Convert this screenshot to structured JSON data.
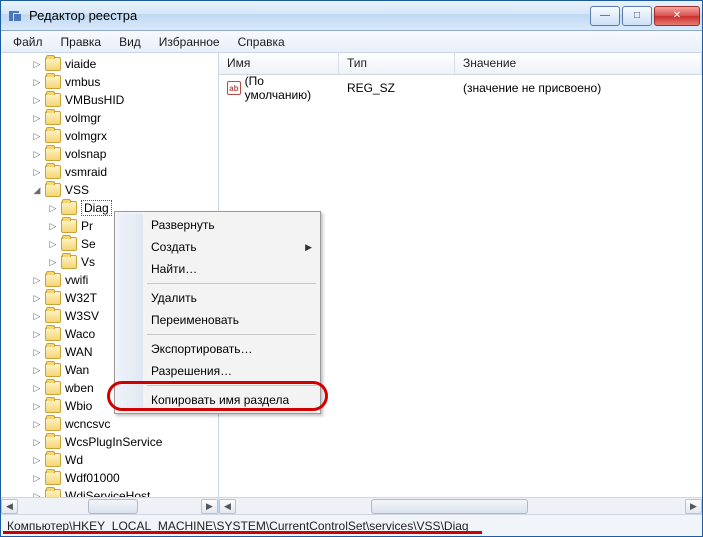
{
  "window": {
    "title": "Редактор реестра"
  },
  "menu": {
    "file": "Файл",
    "edit": "Правка",
    "view": "Вид",
    "favorites": "Избранное",
    "help": "Справка"
  },
  "tree": {
    "items": [
      {
        "label": "viaide",
        "level": 1,
        "tw": "▷"
      },
      {
        "label": "vmbus",
        "level": 1,
        "tw": "▷"
      },
      {
        "label": "VMBusHID",
        "level": 1,
        "tw": "▷"
      },
      {
        "label": "volmgr",
        "level": 1,
        "tw": "▷"
      },
      {
        "label": "volmgrx",
        "level": 1,
        "tw": "▷"
      },
      {
        "label": "volsnap",
        "level": 1,
        "tw": "▷"
      },
      {
        "label": "vsmraid",
        "level": 1,
        "tw": "▷"
      },
      {
        "label": "VSS",
        "level": 1,
        "tw": "◢"
      },
      {
        "label": "Diag",
        "level": 2,
        "tw": "▷",
        "selected": true
      },
      {
        "label": "Pr",
        "level": 2,
        "tw": "▷"
      },
      {
        "label": "Se",
        "level": 2,
        "tw": "▷"
      },
      {
        "label": "Vs",
        "level": 2,
        "tw": "▷"
      },
      {
        "label": "vwifi",
        "level": 1,
        "tw": "▷"
      },
      {
        "label": "W32T",
        "level": 1,
        "tw": "▷"
      },
      {
        "label": "W3SV",
        "level": 1,
        "tw": "▷"
      },
      {
        "label": "Waco",
        "level": 1,
        "tw": "▷"
      },
      {
        "label": "WAN",
        "level": 1,
        "tw": "▷"
      },
      {
        "label": "Wan",
        "level": 1,
        "tw": "▷"
      },
      {
        "label": "wben",
        "level": 1,
        "tw": "▷"
      },
      {
        "label": "Wbio",
        "level": 1,
        "tw": "▷"
      },
      {
        "label": "wcncsvc",
        "level": 1,
        "tw": "▷"
      },
      {
        "label": "WcsPlugInService",
        "level": 1,
        "tw": "▷"
      },
      {
        "label": "Wd",
        "level": 1,
        "tw": "▷"
      },
      {
        "label": "Wdf01000",
        "level": 1,
        "tw": "▷"
      },
      {
        "label": "WdiServiceHost",
        "level": 1,
        "tw": "▷"
      }
    ]
  },
  "list": {
    "columns": {
      "name": "Имя",
      "type": "Тип",
      "value": "Значение"
    },
    "rows": [
      {
        "name": "(По умолчанию)",
        "type": "REG_SZ",
        "value": "(значение не присвоено)",
        "icon": "ab"
      }
    ]
  },
  "context_menu": {
    "expand": "Развернуть",
    "new": "Создать",
    "find": "Найти…",
    "delete": "Удалить",
    "rename": "Переименовать",
    "export": "Экспортировать…",
    "permissions": "Разрешения…",
    "copy_key": "Копировать имя раздела"
  },
  "statusbar": {
    "path": "Компьютер\\HKEY_LOCAL_MACHINE\\SYSTEM\\CurrentControlSet\\services\\VSS\\Diag"
  }
}
